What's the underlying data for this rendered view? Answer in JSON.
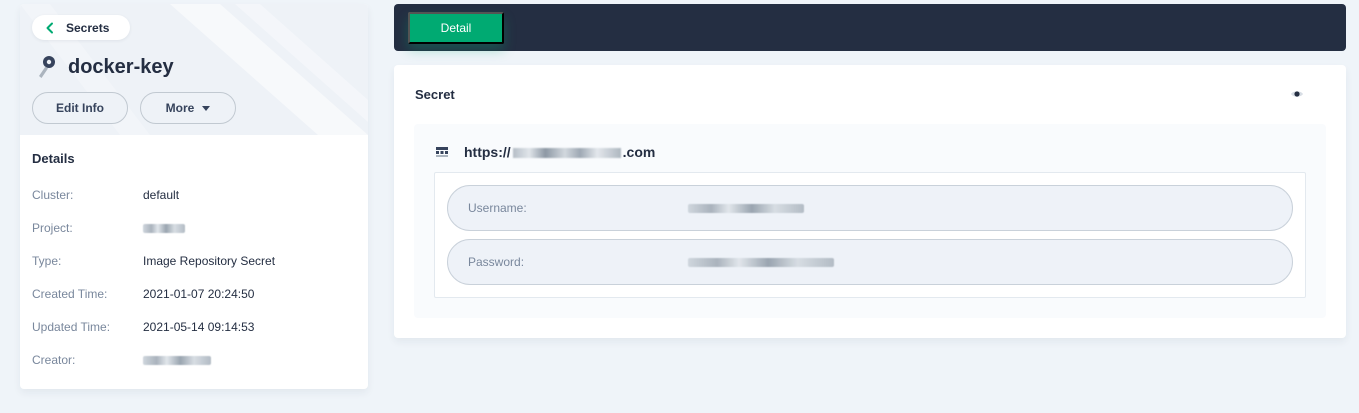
{
  "header": {
    "back_label": "Secrets",
    "title": "docker-key",
    "edit_label": "Edit Info",
    "more_label": "More"
  },
  "details": {
    "heading": "Details",
    "rows": [
      {
        "label": "Cluster:",
        "value": "default"
      },
      {
        "label": "Project:",
        "value": ""
      },
      {
        "label": "Type:",
        "value": "Image Repository Secret"
      },
      {
        "label": "Created Time:",
        "value": "2021-01-07 20:24:50"
      },
      {
        "label": "Updated Time:",
        "value": "2021-05-14 09:14:53"
      },
      {
        "label": "Creator:",
        "value": ""
      }
    ]
  },
  "tabs": [
    {
      "label": "Detail",
      "active": true
    }
  ],
  "secret": {
    "title": "Secret",
    "registry_prefix": "https://",
    "registry_suffix": ".com",
    "username_label": "Username:",
    "password_label": "Password:"
  },
  "icons": {
    "back": "chevron-left-icon",
    "key": "key-icon",
    "more": "caret-down-icon",
    "eye": "eye-icon",
    "registry": "grid-icon"
  },
  "colors": {
    "primary": "#00aa72",
    "dark": "#242e42",
    "background": "#eff4f9"
  }
}
